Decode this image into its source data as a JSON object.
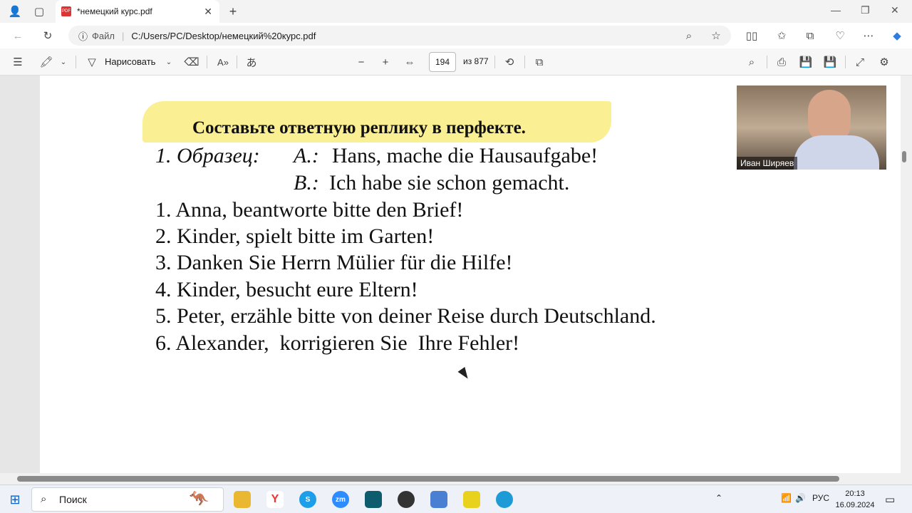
{
  "browser": {
    "tab_title": "*немецкий курс.pdf",
    "file_label": "Файл",
    "url": "C:/Users/PC/Desktop/немецкий%20курс.pdf"
  },
  "pdf_toolbar": {
    "draw_label": "Нарисовать",
    "current_page": "194",
    "page_total": "из 877"
  },
  "document": {
    "title": "Составьте ответную реплику в перфекте.",
    "example_label": "1. Образец:",
    "example_a_label": "А.:",
    "example_a_text": "Hans, mache die Hausaufgabe!",
    "example_b_label": "В.:",
    "example_b_text": "Ich habe sie schon gemacht.",
    "items": [
      "1. Anna, beantworte bitte den Brief!",
      "2. Kinder, spielt bitte im Garten!",
      "3. Danken Sie Herrn Mülier für die Hilfe!",
      "4. Kinder, besucht eure Eltern!",
      "5. Peter, erzähle bitte von deiner Reise durch Deutschland.",
      "6. Alexander,  korrigieren Sie  Ihre Fehler!"
    ]
  },
  "video_call": {
    "participant_name": "Иван Ширяев"
  },
  "taskbar": {
    "search_label": "Поиск",
    "language": "РУС",
    "time": "20:13",
    "date": "16.09.2024"
  },
  "icons": [
    "profile-icon",
    "tabs-icon",
    "pdf-file-icon",
    "close-icon",
    "new-tab-icon",
    "back-icon",
    "refresh-icon",
    "info-icon",
    "zoom-icon",
    "favorite-star-icon",
    "split-screen-icon",
    "favorites-icon",
    "collections-icon",
    "health-icon",
    "more-icon",
    "copilot-icon",
    "contents-icon",
    "highlight-icon",
    "draw-icon",
    "eraser-icon",
    "read-aloud-icon",
    "translate-icon",
    "zoom-out-icon",
    "zoom-in-icon",
    "fit-page-icon",
    "rotate-icon",
    "page-view-icon",
    "search-icon",
    "print-icon",
    "save-icon",
    "save-as-icon",
    "expand-icon",
    "settings-icon",
    "windows-start-icon"
  ]
}
